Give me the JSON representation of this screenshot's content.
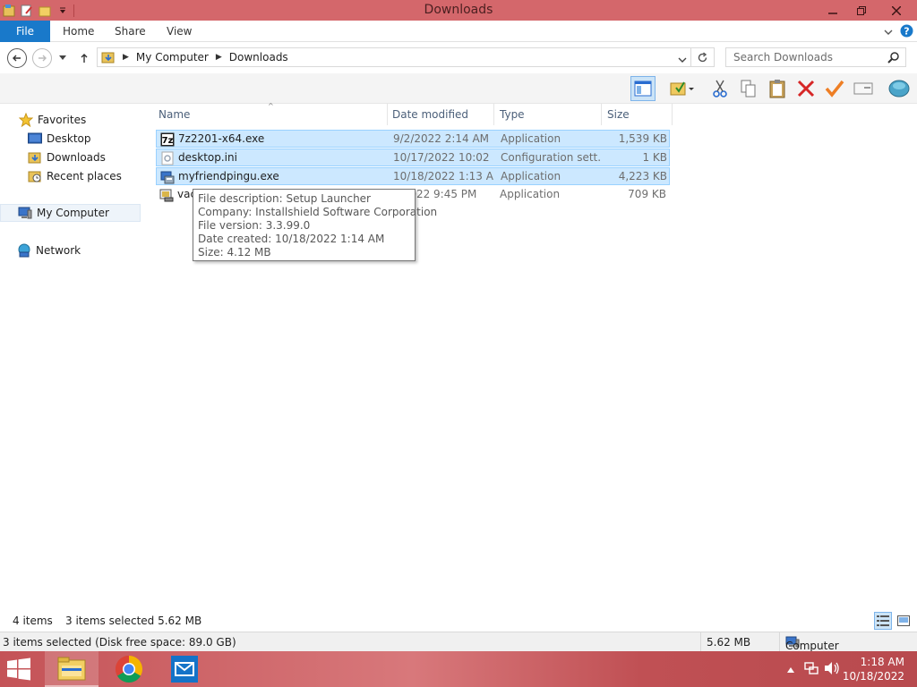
{
  "window": {
    "title": "Downloads"
  },
  "ribbon": {
    "file": "File",
    "tabs": [
      "Home",
      "Share",
      "View"
    ]
  },
  "address": {
    "crumbs": [
      "My Computer",
      "Downloads"
    ],
    "search_placeholder": "Search Downloads"
  },
  "nav": {
    "favorites": "Favorites",
    "items": [
      "Desktop",
      "Downloads",
      "Recent places"
    ],
    "my_computer": "My Computer",
    "network": "Network"
  },
  "columns": {
    "name": "Name",
    "date": "Date modified",
    "type": "Type",
    "size": "Size"
  },
  "files": [
    {
      "name": "7z2201-x64.exe",
      "date": "9/2/2022 2:14 AM",
      "type": "Application",
      "size": "1,539 KB",
      "selected": true,
      "icon": "7zip-icon"
    },
    {
      "name": "desktop.ini",
      "date": "10/17/2022 10:02 ...",
      "type": "Configuration sett...",
      "size": "1 KB",
      "selected": true,
      "icon": "config-file-icon"
    },
    {
      "name": "myfriendpingu.exe",
      "date": "10/18/2022 1:13 AM",
      "type": "Application",
      "size": "4,223 KB",
      "selected": true,
      "icon": "setup-icon"
    },
    {
      "name": "vac",
      "date": "7/2022 9:45 PM",
      "type": "Application",
      "size": "709 KB",
      "selected": false,
      "icon": "app-icon"
    }
  ],
  "tooltip": {
    "lines": [
      "File description: Setup Launcher",
      "Company: Installshield Software Corporation",
      "File version: 3.3.99.0",
      "Date created: 10/18/2022 1:14 AM",
      "Size: 4.12 MB"
    ]
  },
  "status": {
    "items": "4 items",
    "selected": "3 items selected  5.62 MB"
  },
  "details": {
    "left": "3 items selected (Disk free space: 89.0 GB)",
    "size": "5.62 MB",
    "location": "Computer"
  },
  "clock": {
    "time": "1:18 AM",
    "date": "10/18/2022"
  },
  "colors": {
    "title_bar": "#d4676b",
    "file_tab": "#1979ca",
    "selection": "#cce8ff",
    "taskbar": "#c45357"
  }
}
